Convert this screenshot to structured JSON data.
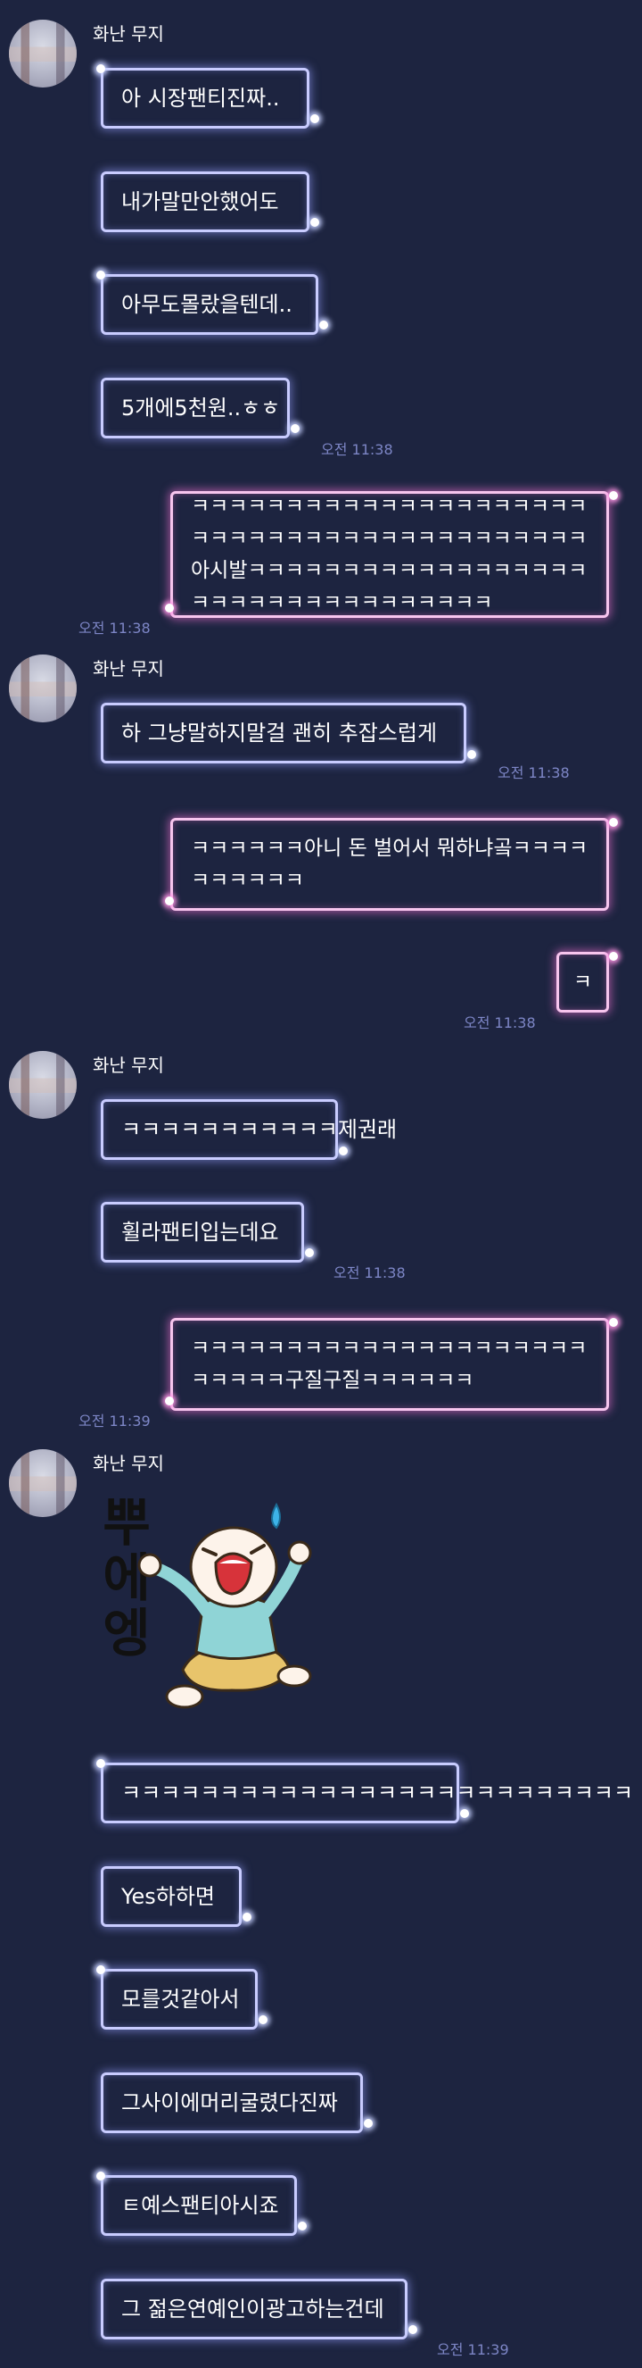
{
  "sender_name": "화난 무지",
  "messages": {
    "m1": "아 시장팬티진짜..",
    "m2": "내가말만안했어도",
    "m3": "아무도몰랐을텐데..",
    "m4": "5개에5천원..ㅎㅎ",
    "m5": "ㅋㅋㅋㅋㅋㅋㅋㅋㅋㅋㅋㅋㅋㅋㅋㅋㅋㅋㅋㅋㅋㅋㅋㅋㅋㅋㅋㅋㅋㅋㅋㅋㅋㅋㅋㅋㅋㅋㅋㅋㅋㅋ아시발ㅋㅋㅋㅋㅋㅋㅋㅋㅋㅋㅋㅋㅋㅋㅋㅋㅋㅋㅋㅋㅋㅋㅋㅋㅋㅋㅋㅋㅋㅋㅋㅋㅋㅋ",
    "m6": "하 그냥말하지말걸 괜히 추잡스럽게",
    "m7": "ㅋㅋㅋㅋㅋㅋ아니 돈 벌어서 뭐하냐곸ㅋㅋㅋㅋㅋㅋㅋㅋㅋㅋ",
    "m8": "ㅋ",
    "m9": "ㅋㅋㅋㅋㅋㅋㅋㅋㅋㅋㅋ제권래",
    "m10": "휠라팬티입는데요",
    "m11": "ㅋㅋㅋㅋㅋㅋㅋㅋㅋㅋㅋㅋㅋㅋㅋㅋㅋㅋㅋㅋㅋㅋㅋㅋㅋㅋ구질구질ㅋㅋㅋㅋㅋㅋ",
    "m12": "ㅋㅋㅋㅋㅋㅋㅋㅋㅋㅋㅋㅋㅋㅋㅋㅋㅋㅋㅋㅋㅋㅋㅋㅋㅋㅋ",
    "m13": "Yes하하면",
    "m14": "모를것같아서",
    "m15": "그사이에머리굴렸다진짜",
    "m16": "ㅌ예스팬티아시죠",
    "m17": "그 젊은연예인이광고하는건데"
  },
  "times": {
    "t1": "오전 11:38",
    "t2": "오전 11:38",
    "t3": "오전 11:38",
    "t4": "오전 11:38",
    "t5": "오전 11:38",
    "t6": "오전 11:39",
    "t7": "오전 11:39"
  },
  "sticker": {
    "text": "뿌에엥",
    "icon": "crying-muzi-sticker"
  },
  "colors": {
    "background": "#1d2440",
    "received_border": "#c9ccff",
    "sent_border": "#f7c5ee",
    "time_text": "#7d86c6"
  }
}
